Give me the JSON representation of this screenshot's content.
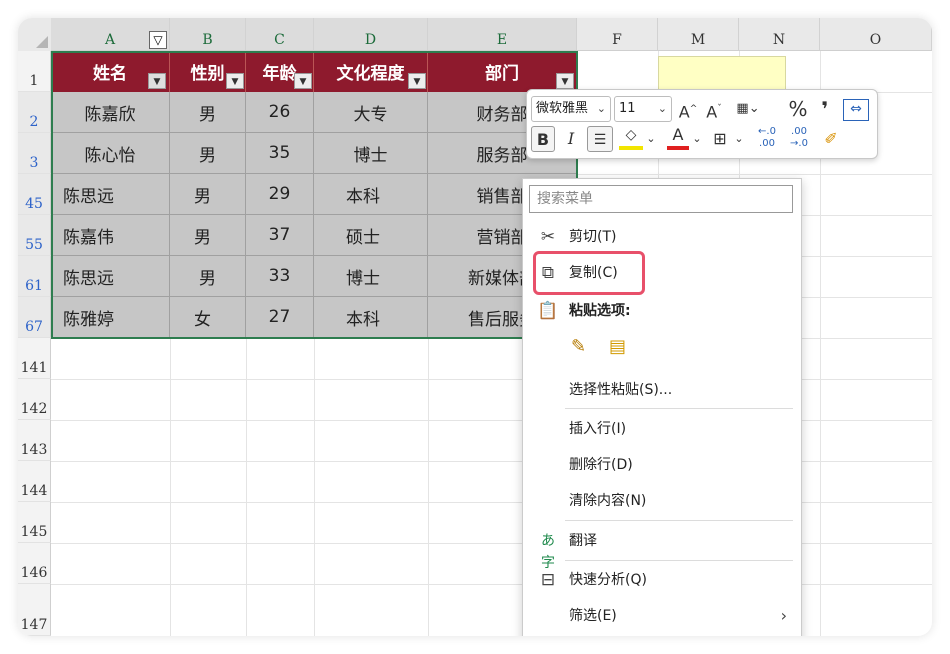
{
  "columns": [
    "A",
    "B",
    "C",
    "D",
    "E",
    "F",
    "M",
    "N",
    "O"
  ],
  "rows": [
    "1",
    "2",
    "3",
    "45",
    "55",
    "61",
    "67",
    "141",
    "142",
    "143",
    "144",
    "145",
    "146",
    "147"
  ],
  "table": {
    "headers": [
      "姓名",
      "性别",
      "年龄",
      "文化程度",
      "部门"
    ],
    "rows": [
      [
        "陈嘉欣",
        "男",
        "26",
        "大专",
        "财务部"
      ],
      [
        "陈心怡",
        "男",
        "35",
        "博士",
        "服务部"
      ],
      [
        "陈思远",
        "男",
        "29",
        "本科",
        "销售部"
      ],
      [
        "陈嘉伟",
        "男",
        "37",
        "硕士",
        "营销部"
      ],
      [
        "陈思远",
        "男",
        "33",
        "博士",
        "新媒体部"
      ],
      [
        "陈雅婷",
        "女",
        "27",
        "本科",
        "售后服务"
      ]
    ]
  },
  "minibar": {
    "font_name": "微软雅黑",
    "font_size": "11",
    "grow_font": "A",
    "shrink_font": "A",
    "percent": "%",
    "comma": "❜",
    "bold": "B",
    "italic": "I"
  },
  "context_menu": {
    "search_placeholder": "搜索菜单",
    "items": [
      {
        "label": "剪切(T)",
        "icon": "scissors-icon"
      },
      {
        "label": "复制(C)",
        "icon": "copy-icon"
      },
      {
        "label": "粘贴选项:",
        "icon": "paste-icon"
      },
      {
        "label": "选择性粘贴(S)...",
        "icon": ""
      },
      {
        "label": "插入行(I)",
        "icon": ""
      },
      {
        "label": "删除行(D)",
        "icon": ""
      },
      {
        "label": "清除内容(N)",
        "icon": ""
      },
      {
        "label": "翻译",
        "icon": "translate-icon"
      },
      {
        "label": "快速分析(Q)",
        "icon": "quick-analysis-icon"
      },
      {
        "label": "筛选(E)",
        "icon": ""
      }
    ]
  },
  "colors": {
    "header_bg": "#8e1a2d",
    "cell_bg": "#c6c6c6",
    "table_border": "#2e7d4f",
    "highlight": "#e8506a"
  }
}
